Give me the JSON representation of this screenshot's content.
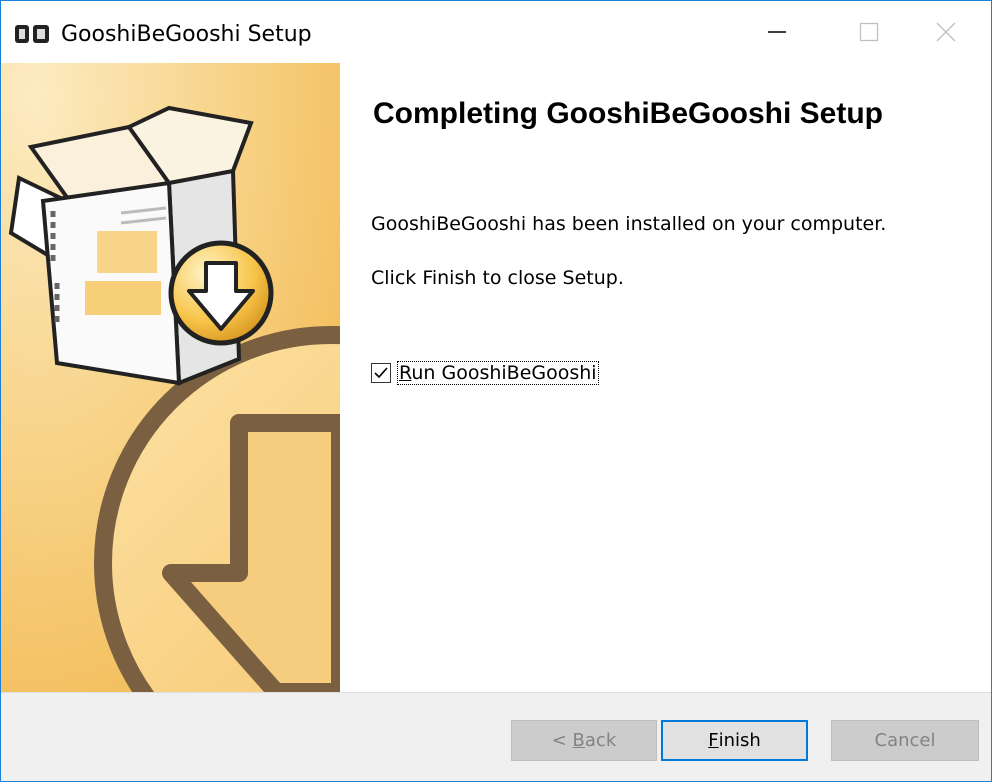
{
  "window": {
    "title": "GooshiBeGooshi Setup",
    "controls": {
      "minimize": "minimize-icon",
      "maximize": "maximize-icon",
      "close": "close-icon"
    }
  },
  "sidebar": {
    "graphic": "installer-box-download-illustration"
  },
  "content": {
    "heading": "Completing GooshiBeGooshi Setup",
    "message1": "GooshiBeGooshi has been installed on your computer.",
    "message2": "Click Finish to close Setup.",
    "run_checkbox": {
      "checked": true,
      "label_accel": "R",
      "label_rest": "un GooshiBeGooshi"
    }
  },
  "footer": {
    "back": {
      "prefix": "< ",
      "accel": "B",
      "rest": "ack",
      "enabled": false
    },
    "finish": {
      "accel": "F",
      "rest": "inish",
      "enabled": true
    },
    "cancel": {
      "label": "Cancel",
      "enabled": false
    }
  },
  "colors": {
    "accent": "#0078d7",
    "sidebar_light": "#fbe0a8",
    "sidebar_mid": "#f6c66d",
    "sidebar_dark": "#7a6040"
  }
}
